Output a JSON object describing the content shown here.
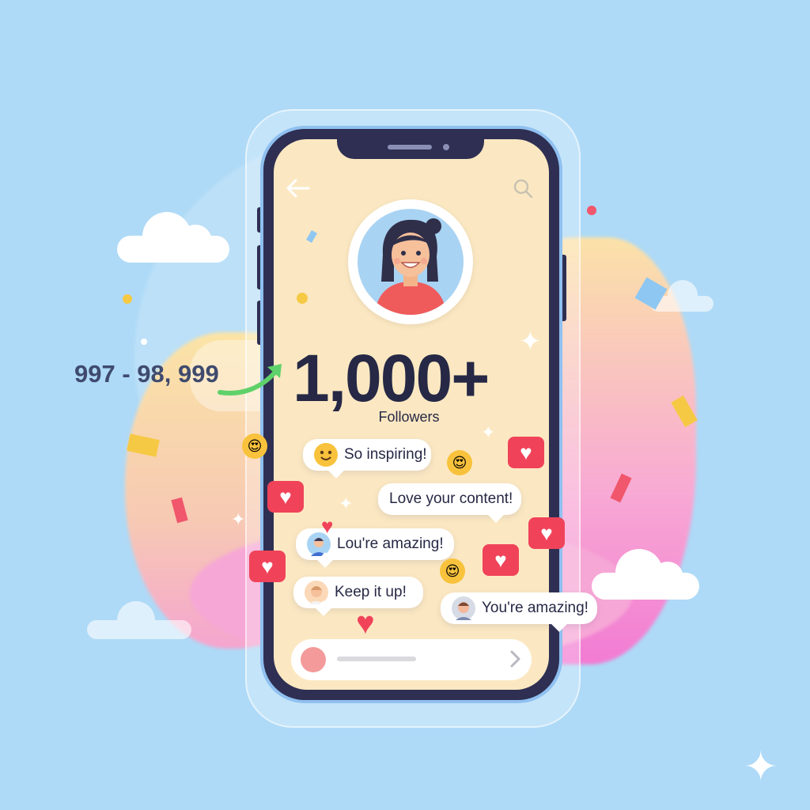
{
  "topbar": {
    "back_icon": "back-arrow-icon",
    "search_icon": "search-icon"
  },
  "profile": {
    "avatar_icon": "user-avatar"
  },
  "milestone": {
    "range_text": "997 - 98, 999",
    "count": "1,000+",
    "label": "Followers"
  },
  "comments": [
    {
      "text": "So inspiring!"
    },
    {
      "text": "Love your content!"
    },
    {
      "text": "Lou're amazing!"
    },
    {
      "text": "Keep it up!"
    },
    {
      "text": "You're amazing!"
    }
  ],
  "reactions": {
    "heart_symbol": "♥",
    "heart_badge_symbol": "♥"
  },
  "composer": {
    "send_icon": "chevron-right-icon"
  },
  "colors": {
    "background": "#aedaf7",
    "screen": "#fbe8c2",
    "phone_frame": "#2e2f52",
    "heart": "#f0435a",
    "text": "#262845",
    "arrow": "#5fd16a"
  }
}
